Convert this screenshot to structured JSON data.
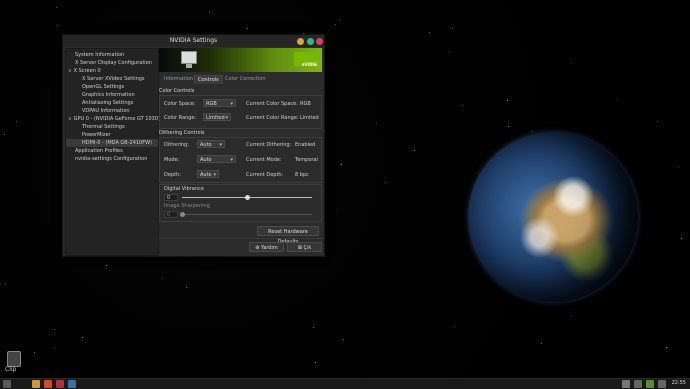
{
  "window": {
    "title": "NVIDIA Settings"
  },
  "sidebar": {
    "items": [
      {
        "label": "System Information",
        "expander": ""
      },
      {
        "label": "X Server Display Configuration",
        "expander": ""
      },
      {
        "label": "X Screen 0",
        "expander": "∨"
      },
      {
        "label": "X Server XVideo Settings",
        "expander": ""
      },
      {
        "label": "OpenGL Settings",
        "expander": ""
      },
      {
        "label": "Graphics Information",
        "expander": ""
      },
      {
        "label": "Antialiasing Settings",
        "expander": ""
      },
      {
        "label": "VDPAU Information",
        "expander": ""
      },
      {
        "label": "GPU 0 - (NVIDIA GeForce GT 1030)",
        "expander": "∨"
      },
      {
        "label": "Thermal Settings",
        "expander": ""
      },
      {
        "label": "PowerMizer",
        "expander": ""
      },
      {
        "label": "HDMI-0 - (MDA GB-2410FW)",
        "expander": ""
      },
      {
        "label": "Application Profiles",
        "expander": ""
      },
      {
        "label": "nvidia-settings Configuration",
        "expander": ""
      }
    ]
  },
  "banner": {
    "logo_text": "nVIDIA"
  },
  "tabs": [
    {
      "label": "Information"
    },
    {
      "label": "Controls"
    },
    {
      "label": "Color Correction"
    }
  ],
  "color_controls": {
    "title": "Color Controls",
    "color_space_label": "Color Space:",
    "color_space_value": "RGB",
    "current_color_space_label": "Current Color Space:",
    "current_color_space_value": "RGB",
    "color_range_label": "Color Range:",
    "color_range_value": "Limited",
    "current_color_range_label": "Current Color Range:",
    "current_color_range_value": "Limited"
  },
  "dithering_controls": {
    "title": "Dithering Controls",
    "dithering_label": "Dithering:",
    "dithering_value": "Auto",
    "current_dithering_label": "Current Dithering:",
    "current_dithering_value": "Enabled",
    "mode_label": "Mode:",
    "mode_value": "Auto",
    "current_mode_label": "Current Mode:",
    "current_mode_value": "Temporal",
    "depth_label": "Depth:",
    "depth_value": "Auto",
    "current_depth_label": "Current Depth:",
    "current_depth_value": "8 bpc"
  },
  "digital_vibrance": {
    "title": "Digital Vibrance",
    "value": "0",
    "level": 0.5
  },
  "image_sharpening": {
    "title": "Image Sharpening",
    "value": "0",
    "level": 0.0
  },
  "buttons": {
    "reset": "Reset Hardware Defaults",
    "help": "Yardım",
    "quit": "Çık"
  },
  "desktop": {
    "clip_label": "Clip"
  },
  "taskbar": {
    "clock": "22:55"
  }
}
